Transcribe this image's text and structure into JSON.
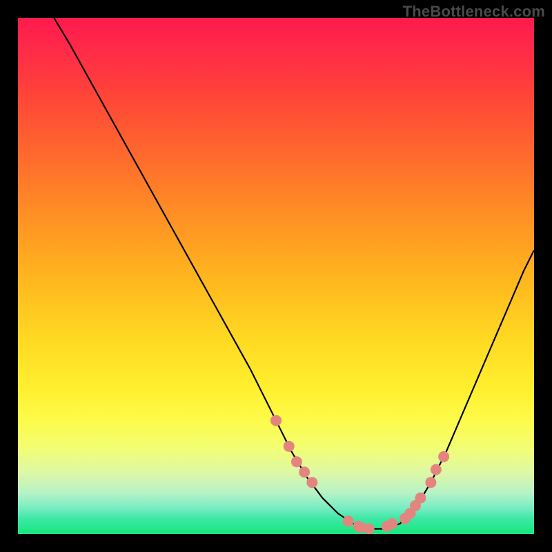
{
  "watermark": "TheBottleneck.com",
  "colors": {
    "dot": "#e3857e",
    "curve": "#000000",
    "background": "#000000"
  },
  "chart_data": {
    "type": "line",
    "title": "",
    "xlabel": "",
    "ylabel": "",
    "xlim": [
      0,
      100
    ],
    "ylim": [
      0,
      100
    ],
    "grid": false,
    "legend": false,
    "series": [
      {
        "name": "bottleneck-curve",
        "x": [
          7,
          10,
          15,
          20,
          25,
          30,
          35,
          40,
          45,
          50,
          53,
          56,
          59,
          62,
          65,
          68,
          71,
          74,
          77,
          80,
          83,
          86,
          89,
          92,
          95,
          98,
          100
        ],
        "y": [
          100,
          95,
          86,
          77,
          68,
          59,
          50,
          41,
          32,
          22,
          16,
          11,
          7,
          4,
          2,
          1,
          1,
          2,
          5,
          10,
          16,
          23,
          30,
          37,
          44,
          51,
          55
        ]
      }
    ],
    "points": {
      "name": "highlighted-models",
      "x": [
        50.0,
        52.5,
        54.0,
        55.5,
        57.0,
        64.0,
        66.0,
        66.5,
        68.0,
        71.5,
        72.5,
        75.0,
        76.0,
        77.0,
        78.0,
        80.0,
        81.0,
        82.5
      ],
      "y": [
        22.0,
        17.0,
        14.0,
        12.0,
        10.0,
        2.5,
        1.5,
        1.3,
        1.0,
        1.5,
        2.0,
        3.0,
        4.0,
        5.5,
        7.0,
        10.0,
        12.5,
        15.0
      ]
    }
  }
}
